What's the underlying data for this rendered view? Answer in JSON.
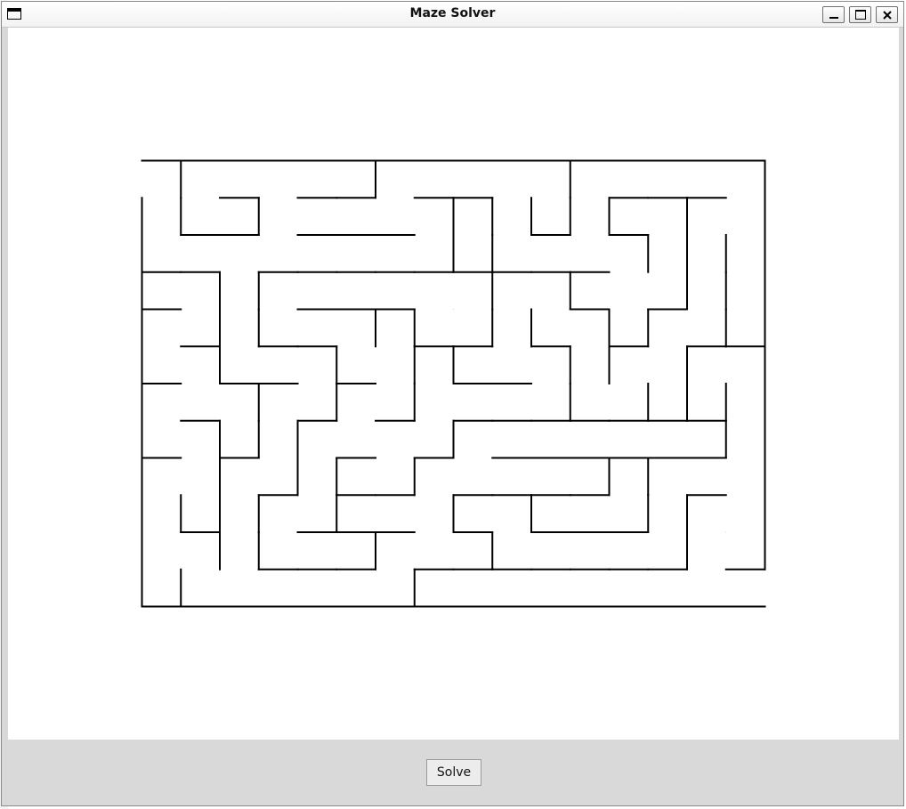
{
  "window": {
    "title": "Maze Solver",
    "controls": [
      "minimize",
      "maximize",
      "close"
    ]
  },
  "maze": {
    "rows": 12,
    "cols": 16,
    "wall_color": "#000000",
    "grid_hint_color": "#d0d0d0",
    "h_walls": [
      [
        0,
        0
      ],
      [
        1,
        0
      ],
      [
        2,
        0
      ],
      [
        3,
        0
      ],
      [
        4,
        0
      ],
      [
        5,
        0
      ],
      [
        6,
        0
      ],
      [
        7,
        0
      ],
      [
        8,
        0
      ],
      [
        9,
        0
      ],
      [
        10,
        0
      ],
      [
        11,
        0
      ],
      [
        12,
        0
      ],
      [
        13,
        0
      ],
      [
        14,
        0
      ],
      [
        15,
        0
      ],
      [
        2,
        1
      ],
      [
        4,
        1
      ],
      [
        5,
        1
      ],
      [
        7,
        1
      ],
      [
        8,
        1
      ],
      [
        12,
        1
      ],
      [
        13,
        1
      ],
      [
        14,
        1
      ],
      [
        1,
        2
      ],
      [
        2,
        2
      ],
      [
        4,
        2
      ],
      [
        5,
        2
      ],
      [
        6,
        2
      ],
      [
        10,
        2
      ],
      [
        12,
        2
      ],
      [
        0,
        3
      ],
      [
        1,
        3
      ],
      [
        3,
        3
      ],
      [
        4,
        3
      ],
      [
        5,
        3
      ],
      [
        6,
        3
      ],
      [
        7,
        3
      ],
      [
        8,
        3
      ],
      [
        9,
        3
      ],
      [
        10,
        3
      ],
      [
        11,
        3
      ],
      [
        0,
        4
      ],
      [
        4,
        4
      ],
      [
        5,
        4
      ],
      [
        6,
        4
      ],
      [
        11,
        4
      ],
      [
        13,
        4
      ],
      [
        1,
        5
      ],
      [
        3,
        5
      ],
      [
        4,
        5
      ],
      [
        7,
        5
      ],
      [
        8,
        5
      ],
      [
        10,
        5
      ],
      [
        12,
        5
      ],
      [
        14,
        5
      ],
      [
        15,
        5
      ],
      [
        0,
        6
      ],
      [
        2,
        6
      ],
      [
        3,
        6
      ],
      [
        5,
        6
      ],
      [
        8,
        6
      ],
      [
        9,
        6
      ],
      [
        1,
        7
      ],
      [
        4,
        7
      ],
      [
        6,
        7
      ],
      [
        8,
        7
      ],
      [
        9,
        7
      ],
      [
        10,
        7
      ],
      [
        11,
        7
      ],
      [
        12,
        7
      ],
      [
        13,
        7
      ],
      [
        14,
        7
      ],
      [
        0,
        8
      ],
      [
        2,
        8
      ],
      [
        5,
        8
      ],
      [
        7,
        8
      ],
      [
        9,
        8
      ],
      [
        10,
        8
      ],
      [
        11,
        8
      ],
      [
        12,
        8
      ],
      [
        13,
        8
      ],
      [
        14,
        8
      ],
      [
        3,
        9
      ],
      [
        5,
        9
      ],
      [
        6,
        9
      ],
      [
        8,
        9
      ],
      [
        9,
        9
      ],
      [
        10,
        9
      ],
      [
        11,
        9
      ],
      [
        14,
        9
      ],
      [
        1,
        10
      ],
      [
        4,
        10
      ],
      [
        5,
        10
      ],
      [
        6,
        10
      ],
      [
        8,
        10
      ],
      [
        10,
        10
      ],
      [
        11,
        10
      ],
      [
        12,
        10
      ],
      [
        3,
        11
      ],
      [
        4,
        11
      ],
      [
        5,
        11
      ],
      [
        7,
        11
      ],
      [
        8,
        11
      ],
      [
        9,
        11
      ],
      [
        10,
        11
      ],
      [
        11,
        11
      ],
      [
        12,
        11
      ],
      [
        13,
        11
      ],
      [
        15,
        11
      ],
      [
        0,
        12
      ],
      [
        1,
        12
      ],
      [
        2,
        12
      ],
      [
        3,
        12
      ],
      [
        4,
        12
      ],
      [
        5,
        12
      ],
      [
        6,
        12
      ],
      [
        7,
        12
      ],
      [
        8,
        12
      ],
      [
        9,
        12
      ],
      [
        10,
        12
      ],
      [
        11,
        12
      ],
      [
        12,
        12
      ],
      [
        13,
        12
      ],
      [
        14,
        12
      ],
      [
        15,
        12
      ]
    ],
    "v_walls": [
      [
        0,
        1
      ],
      [
        0,
        2
      ],
      [
        0,
        3
      ],
      [
        0,
        4
      ],
      [
        0,
        5
      ],
      [
        0,
        6
      ],
      [
        0,
        7
      ],
      [
        0,
        8
      ],
      [
        0,
        9
      ],
      [
        0,
        10
      ],
      [
        0,
        11
      ],
      [
        1,
        0
      ],
      [
        1,
        1
      ],
      [
        1,
        9
      ],
      [
        1,
        11
      ],
      [
        2,
        3
      ],
      [
        2,
        4
      ],
      [
        2,
        5
      ],
      [
        2,
        7
      ],
      [
        2,
        8
      ],
      [
        2,
        9
      ],
      [
        2,
        10
      ],
      [
        3,
        1
      ],
      [
        3,
        3
      ],
      [
        3,
        4
      ],
      [
        3,
        6
      ],
      [
        3,
        7
      ],
      [
        3,
        9
      ],
      [
        3,
        10
      ],
      [
        4,
        7
      ],
      [
        4,
        8
      ],
      [
        5,
        5
      ],
      [
        5,
        6
      ],
      [
        5,
        8
      ],
      [
        5,
        9
      ],
      [
        6,
        0
      ],
      [
        6,
        4
      ],
      [
        6,
        10
      ],
      [
        7,
        4
      ],
      [
        7,
        5
      ],
      [
        7,
        6
      ],
      [
        7,
        8
      ],
      [
        7,
        11
      ],
      [
        8,
        1
      ],
      [
        8,
        2
      ],
      [
        8,
        5
      ],
      [
        8,
        7
      ],
      [
        8,
        9
      ],
      [
        9,
        1
      ],
      [
        9,
        2
      ],
      [
        9,
        3
      ],
      [
        9,
        4
      ],
      [
        9,
        10
      ],
      [
        10,
        1
      ],
      [
        10,
        4
      ],
      [
        10,
        9
      ],
      [
        11,
        0
      ],
      [
        11,
        1
      ],
      [
        11,
        3
      ],
      [
        11,
        5
      ],
      [
        11,
        6
      ],
      [
        12,
        1
      ],
      [
        12,
        4
      ],
      [
        12,
        5
      ],
      [
        12,
        8
      ],
      [
        13,
        2
      ],
      [
        13,
        4
      ],
      [
        13,
        6
      ],
      [
        13,
        8
      ],
      [
        13,
        9
      ],
      [
        14,
        1
      ],
      [
        14,
        2
      ],
      [
        14,
        3
      ],
      [
        14,
        5
      ],
      [
        14,
        6
      ],
      [
        14,
        9
      ],
      [
        14,
        10
      ],
      [
        15,
        2
      ],
      [
        15,
        3
      ],
      [
        15,
        4
      ],
      [
        15,
        6
      ],
      [
        15,
        7
      ],
      [
        16,
        0
      ],
      [
        16,
        1
      ],
      [
        16,
        2
      ],
      [
        16,
        3
      ],
      [
        16,
        4
      ],
      [
        16,
        5
      ],
      [
        16,
        6
      ],
      [
        16,
        7
      ],
      [
        16,
        8
      ],
      [
        16,
        9
      ],
      [
        16,
        10
      ]
    ]
  },
  "controls": {
    "solve_label": "Solve"
  }
}
